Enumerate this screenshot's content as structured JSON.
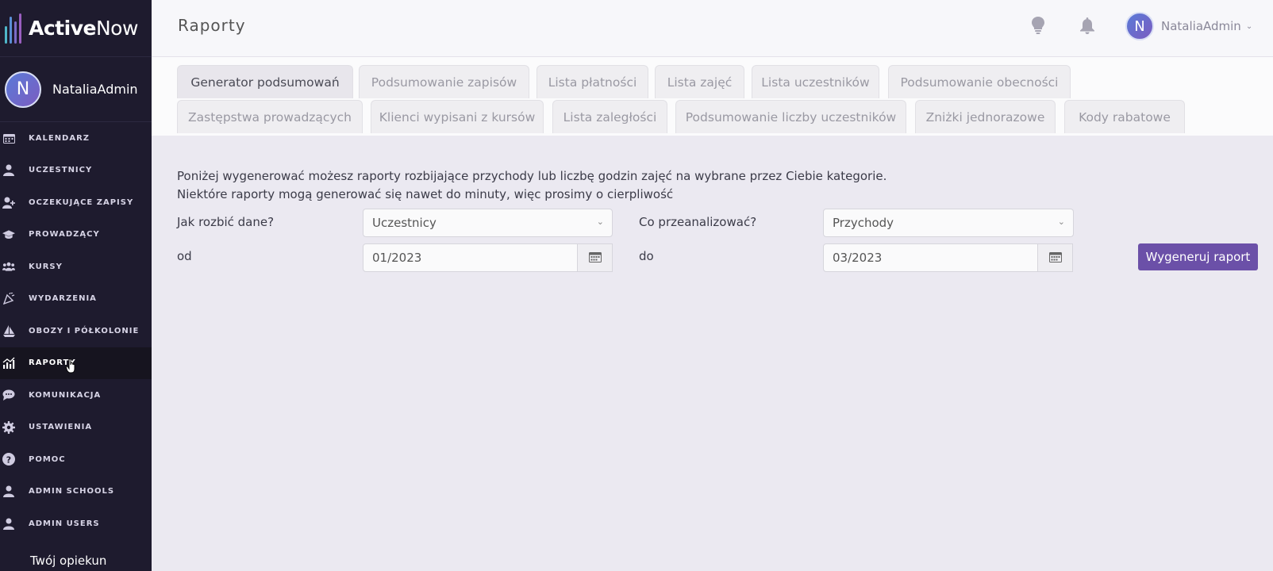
{
  "app": {
    "name_bold": "Active",
    "name_thin": "Now"
  },
  "sidebar": {
    "user": {
      "initial": "N",
      "name": "NataliaAdmin"
    },
    "items": [
      {
        "label": "KALENDARZ",
        "icon": "calendar-icon"
      },
      {
        "label": "UCZESTNICY",
        "icon": "person-icon"
      },
      {
        "label": "OCZEKUJĄCE ZAPISY",
        "icon": "person-add-icon"
      },
      {
        "label": "PROWADZĄCY",
        "icon": "graduation-cap-icon"
      },
      {
        "label": "KURSY",
        "icon": "group-icon"
      },
      {
        "label": "WYDARZENIA",
        "icon": "confetti-icon"
      },
      {
        "label": "OBOZY I PÓŁKOLONIE",
        "icon": "sailboat-icon"
      },
      {
        "label": "RAPORTY",
        "icon": "chart-icon",
        "active": true
      },
      {
        "label": "KOMUNIKACJA",
        "icon": "chat-icon"
      },
      {
        "label": "USTAWIENIA",
        "icon": "gear-icon"
      },
      {
        "label": "POMOC",
        "icon": "help-icon"
      },
      {
        "label": "ADMIN SCHOOLS",
        "icon": "person-icon"
      },
      {
        "label": "ADMIN USERS",
        "icon": "person-icon"
      }
    ],
    "footer_label": "Twój opiekun"
  },
  "header": {
    "title": "Raporty",
    "user": {
      "initial": "N",
      "name": "NataliaAdmin"
    }
  },
  "tabs": {
    "row1": [
      "Generator podsumowań",
      "Podsumowanie zapisów",
      "Lista płatności",
      "Lista zajęć",
      "Lista uczestników",
      "Podsumowanie obecności"
    ],
    "row2": [
      "Zastępstwa prowadzących",
      "Klienci wypisani z kursów",
      "Lista zaległości",
      "Podsumowanie liczby uczestników",
      "Zniżki jednorazowe",
      "Kody rabatowe"
    ],
    "active": "Generator podsumowań"
  },
  "form": {
    "intro_line1": "Poniżej wygenerować możesz raporty rozbijające przychody lub liczbę godzin zajęć na wybrane przez Ciebie kategorie.",
    "intro_line2": "Niektóre raporty mogą generować się nawet do minuty, więc prosimy o cierpliwość",
    "split_label": "Jak rozbić dane?",
    "split_value": "Uczestnicy",
    "analyze_label": "Co przeanalizować?",
    "analyze_value": "Przychody",
    "from_label": "od",
    "from_value": "01/2023",
    "to_label": "do",
    "to_value": "03/2023",
    "generate_label": "Wygeneruj raport"
  },
  "colors": {
    "sidebar_bg": "#1e1b2e",
    "accent": "#6b50a8",
    "content_bg": "#ebe9f1"
  }
}
